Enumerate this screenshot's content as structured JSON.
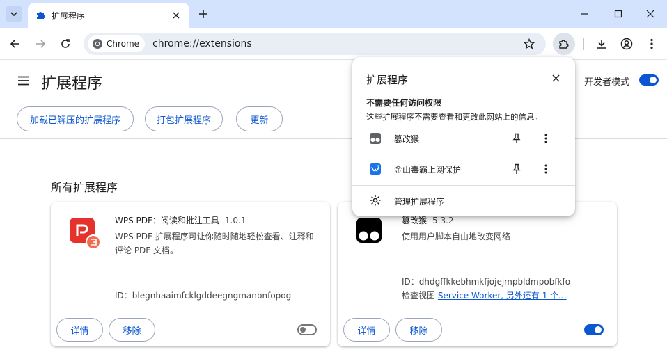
{
  "tab": {
    "title": "扩展程序"
  },
  "omnibox": {
    "chip": "Chrome",
    "url": "chrome://extensions"
  },
  "header": {
    "title": "扩展程序",
    "dev_mode_label": "开发者模式",
    "dev_mode_on": true,
    "buttons": {
      "load_unpacked": "加载已解压的扩展程序",
      "pack": "打包扩展程序",
      "update": "更新"
    }
  },
  "section_title": "所有扩展程序",
  "cards": [
    {
      "name": "WPS PDF：阅读和批注工具",
      "version": "1.0.1",
      "desc": "WPS PDF 扩展程序可让你随时随地轻松查看、注释和评论 PDF 文档。",
      "id": "ID：blegnhaaimfcklgddeegngmanbnfopog",
      "details": "详情",
      "remove": "移除",
      "enabled": false
    },
    {
      "name": "篡改猴",
      "version": "5.3.2",
      "desc": "使用用户脚本自由地改变网络",
      "id": "ID：dhdgffkkebhmkfjojejmpbldmpobfkfo",
      "inspect_label": "检查视图",
      "inspect_link": "Service Worker, 另外还有 1 个...",
      "details": "详情",
      "remove": "移除",
      "enabled": true
    }
  ],
  "popup": {
    "title": "扩展程序",
    "subtitle": "不需要任何访问权限",
    "desc": "这些扩展程序不需要查看和更改此网站上的信息。",
    "items": [
      {
        "name": "篡改猴"
      },
      {
        "name": "金山毒霸上网保护"
      }
    ],
    "manage": "管理扩展程序"
  }
}
